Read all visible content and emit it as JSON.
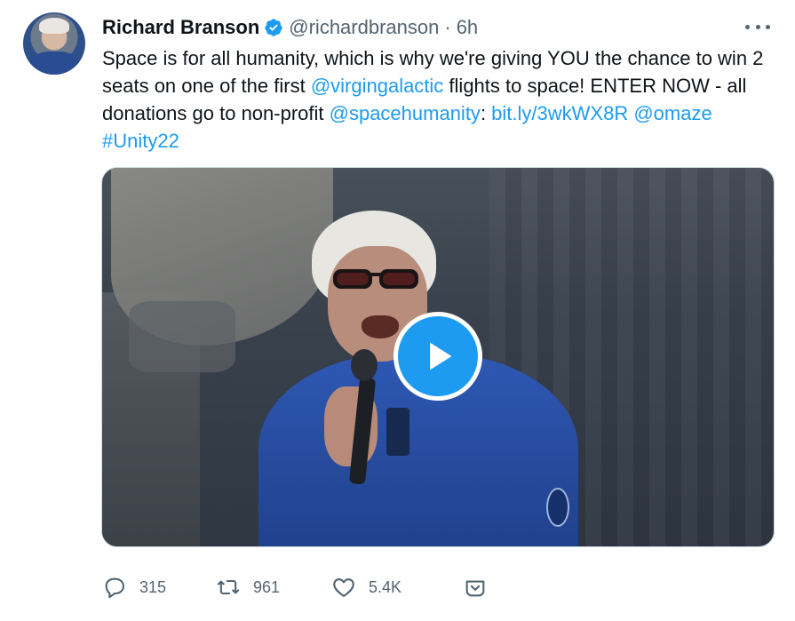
{
  "author": {
    "name": "Richard Branson",
    "handle": "@richardbranson",
    "separator": "·",
    "time": "6h",
    "verified": true
  },
  "tweet": {
    "segments": [
      {
        "text": "Space is for all humanity, which is why we're giving YOU the chance to win 2 seats on one of the first ",
        "link": false
      },
      {
        "text": "@virgingalactic",
        "link": true
      },
      {
        "text": " flights to space! ENTER NOW - all donations go to non-profit ",
        "link": false
      },
      {
        "text": "@spacehumanity",
        "link": true
      },
      {
        "text": ": ",
        "link": false
      },
      {
        "text": "bit.ly/3wkWX8R",
        "link": true
      },
      {
        "text": " ",
        "link": false
      },
      {
        "text": "@omaze",
        "link": true
      },
      {
        "text": " ",
        "link": false
      },
      {
        "text": "#Unity22",
        "link": true
      }
    ]
  },
  "media": {
    "type": "video",
    "play_icon": "play-icon"
  },
  "actions": {
    "reply": {
      "icon": "reply-icon",
      "count": "315"
    },
    "retweet": {
      "icon": "retweet-icon",
      "count": "961"
    },
    "like": {
      "icon": "heart-icon",
      "count": "5.4K"
    },
    "share": {
      "icon": "share-icon"
    }
  },
  "colors": {
    "link": "#1d9bf0",
    "secondary_text": "#536471",
    "primary_text": "#0f1419",
    "verified": "#1d9bf0"
  }
}
